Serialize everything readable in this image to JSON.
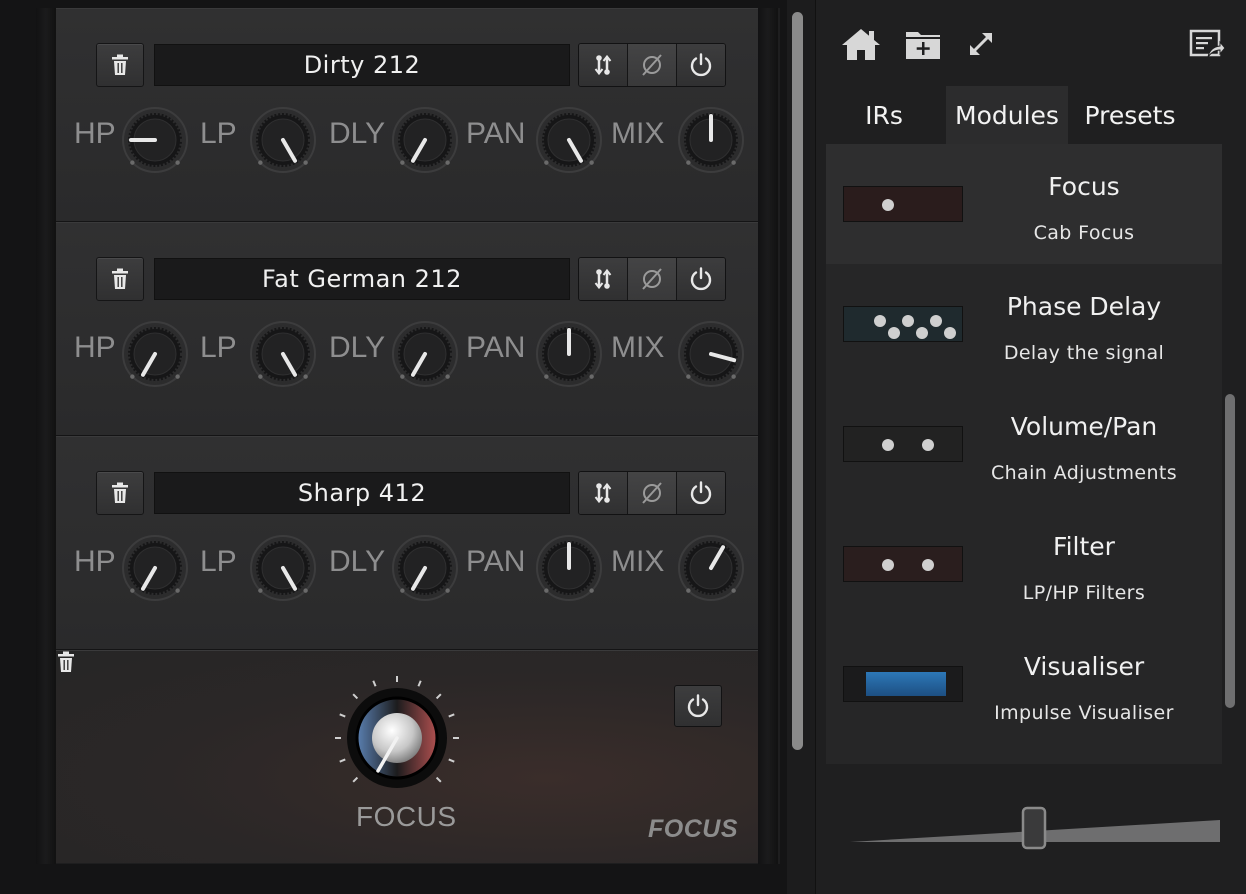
{
  "rack": {
    "modules": [
      {
        "name": "Dirty 212",
        "knobs": [
          {
            "label": "HP",
            "angle": -90
          },
          {
            "label": "LP",
            "angle": 150
          },
          {
            "label": "DLY",
            "angle": -150
          },
          {
            "label": "PAN",
            "angle": 150
          },
          {
            "label": "MIX",
            "angle": 0
          }
        ]
      },
      {
        "name": "Fat German 212",
        "knobs": [
          {
            "label": "HP",
            "angle": -150
          },
          {
            "label": "LP",
            "angle": 150
          },
          {
            "label": "DLY",
            "angle": -150
          },
          {
            "label": "PAN",
            "angle": 0
          },
          {
            "label": "MIX",
            "angle": 105
          }
        ]
      },
      {
        "name": "Sharp 412",
        "knobs": [
          {
            "label": "HP",
            "angle": -150
          },
          {
            "label": "LP",
            "angle": 150
          },
          {
            "label": "DLY",
            "angle": -150
          },
          {
            "label": "PAN",
            "angle": 0
          },
          {
            "label": "MIX",
            "angle": 30
          }
        ]
      }
    ],
    "focus_module": {
      "knob_label": "FOCUS",
      "logo": "FOCUS",
      "knob_angle": -150
    }
  },
  "toolbar": {
    "icons": [
      "home-icon",
      "new-folder-icon",
      "expand-icon",
      "export-icon"
    ]
  },
  "tabs": [
    {
      "label": "IRs",
      "active": false
    },
    {
      "label": "Modules",
      "active": true
    },
    {
      "label": "Presets",
      "active": false
    }
  ],
  "module_list": [
    {
      "title": "Focus",
      "subtitle": "Cab Focus",
      "selected": true
    },
    {
      "title": "Phase Delay",
      "subtitle": "Delay the signal",
      "selected": false
    },
    {
      "title": "Volume/Pan",
      "subtitle": "Chain Adjustments",
      "selected": false
    },
    {
      "title": "Filter",
      "subtitle": "LP/HP Filters",
      "selected": false
    },
    {
      "title": "Visualiser",
      "subtitle": "Impulse Visualiser",
      "selected": false
    }
  ],
  "thumbnail_size_slider": {
    "value": 0.5
  },
  "colors": {
    "accent_dark": "#1a1a1b",
    "knob_pointer": "#e8e8e8",
    "panel": "#262627"
  }
}
